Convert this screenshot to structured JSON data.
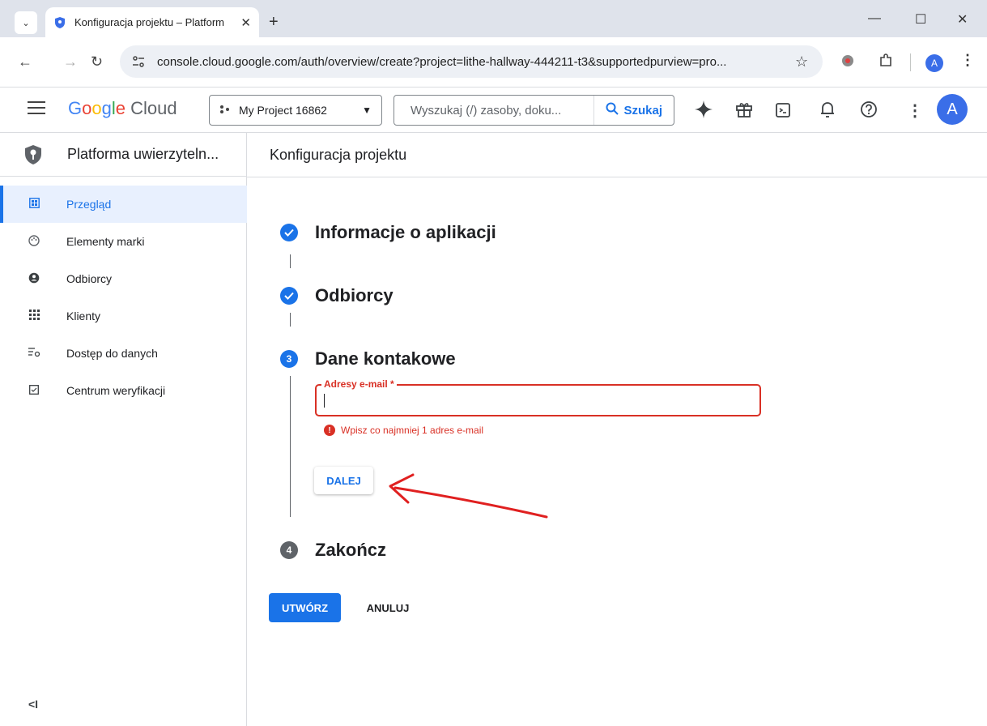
{
  "browser": {
    "tab_title": "Konfiguracja projektu – Platform",
    "url": "console.cloud.google.com/auth/overview/create?project=lithe-hallway-444211-t3&supportedpurview=pro...",
    "profile_initial": "A"
  },
  "header": {
    "logo_google": [
      "G",
      "o",
      "o",
      "g",
      "l",
      "e"
    ],
    "logo_cloud": "Cloud",
    "project_name": "My Project 16862",
    "search_placeholder": "Wyszukaj (/) zasoby, doku...",
    "search_button": "Szukaj",
    "avatar_initial": "A"
  },
  "sidebar": {
    "title": "Platforma uwierzyteln...",
    "items": [
      {
        "label": "Przegląd",
        "icon": "dashboard-icon",
        "active": true
      },
      {
        "label": "Elementy marki",
        "icon": "palette-icon",
        "active": false
      },
      {
        "label": "Odbiorcy",
        "icon": "person-icon",
        "active": false
      },
      {
        "label": "Klienty",
        "icon": "grid-icon",
        "active": false
      },
      {
        "label": "Dostęp do danych",
        "icon": "data-settings-icon",
        "active": false
      },
      {
        "label": "Centrum weryfikacji",
        "icon": "checkbox-icon",
        "active": false
      }
    ],
    "collapse_label": "<I"
  },
  "main": {
    "page_title": "Konfiguracja projektu",
    "steps": [
      {
        "label": "Informacje o aplikacji",
        "state": "done"
      },
      {
        "label": "Odbiorcy",
        "state": "done"
      },
      {
        "label": "Dane kontakowe",
        "state": "current",
        "number": "3"
      },
      {
        "label": "Zakończ",
        "state": "pending",
        "number": "4"
      }
    ],
    "email_field_label": "Adresy e-mail *",
    "email_value": "",
    "error_text": "Wpisz co najmniej 1 adres e-mail",
    "next_button": "DALEJ",
    "create_button": "UTWÓRZ",
    "cancel_button": "ANULUJ"
  },
  "colors": {
    "accent": "#1a73e8",
    "error": "#d93025",
    "annotation": "#e02020"
  }
}
